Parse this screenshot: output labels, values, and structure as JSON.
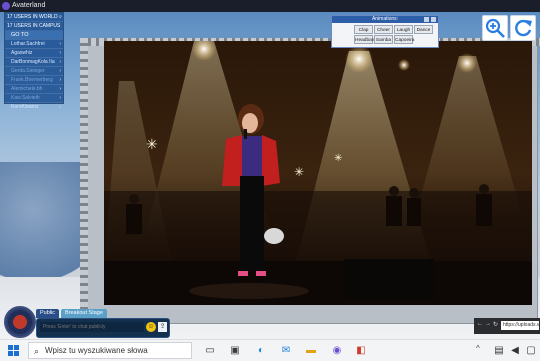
{
  "window": {
    "title": "Avaterland"
  },
  "users_panel": {
    "header_world": "17 USERS IN WORLD",
    "header_campus": "17 USERS IN CAMPUS",
    "goto_label": "GO TO",
    "users": [
      {
        "name": "Lothar.Sachfrei",
        "dim": false
      },
      {
        "name": "Agaswhiz",
        "dim": false
      },
      {
        "name": "DarBonmagKola IIa",
        "dim": false
      },
      {
        "name": "Gerda.Sieinger",
        "dim": true
      },
      {
        "name": "Frank.Boemerberg",
        "dim": true
      },
      {
        "name": "Alemichele.bh",
        "dim": true
      },
      {
        "name": "Kaw.Salvieth",
        "dim": true
      },
      {
        "name": "KoroKiswinz",
        "dim": false
      }
    ]
  },
  "animations": {
    "title": "Animations:",
    "buttons": [
      "Clap",
      "Cheer",
      "Laugh",
      "Dance",
      "Headbang",
      "Samba",
      "Capoeira"
    ]
  },
  "toolbar": {
    "zoom_icon": "zoom-in-icon",
    "refresh_icon": "refresh-icon"
  },
  "chat": {
    "tabs": [
      "Public",
      "Breakout Stage"
    ],
    "placeholder": "Press 'Enter' to chat publicly"
  },
  "browser": {
    "back": "←",
    "forward": "→",
    "reload": "↻",
    "url": "https://uploads.v..."
  },
  "taskbar": {
    "search_placeholder": "Wpisz tu wyszukiwane słowa",
    "tray_chevron": "^"
  },
  "colors": {
    "panel_blue": "#2456a0",
    "accent": "#2d5ea8",
    "stage_red": "#c21f1f"
  }
}
